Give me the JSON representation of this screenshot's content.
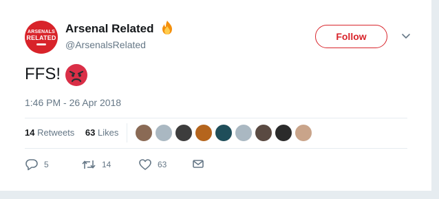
{
  "user": {
    "name": "Arsenal Related",
    "handle": "@ArsenalsRelated",
    "avatar_text_line1": "ARSENALS",
    "avatar_text_line2": "RELATED",
    "name_emoji": "fire-icon"
  },
  "follow_label": "Follow",
  "tweet": {
    "text": "FFS!",
    "emoji": "angry-face-icon",
    "timestamp": "1:46 PM - 26 Apr 2018"
  },
  "stats": {
    "retweets_count": "14",
    "retweets_label": "Retweets",
    "likes_count": "63",
    "likes_label": "Likes"
  },
  "likers": [
    {
      "color": "#8a6a55"
    },
    {
      "color": "#aab8c2"
    },
    {
      "color": "#3d3d3d"
    },
    {
      "color": "#b5651d"
    },
    {
      "color": "#1f4e5a"
    },
    {
      "color": "#aab8c2"
    },
    {
      "color": "#5a4a42"
    },
    {
      "color": "#2b2b2b"
    },
    {
      "color": "#c9a48a"
    }
  ],
  "actions": {
    "reply_count": "5",
    "retweet_count": "14",
    "like_count": "63"
  },
  "colors": {
    "brand_red": "#d8232a",
    "secondary_text": "#657786",
    "primary_text": "#14171a",
    "divider": "#e6ecf0"
  }
}
